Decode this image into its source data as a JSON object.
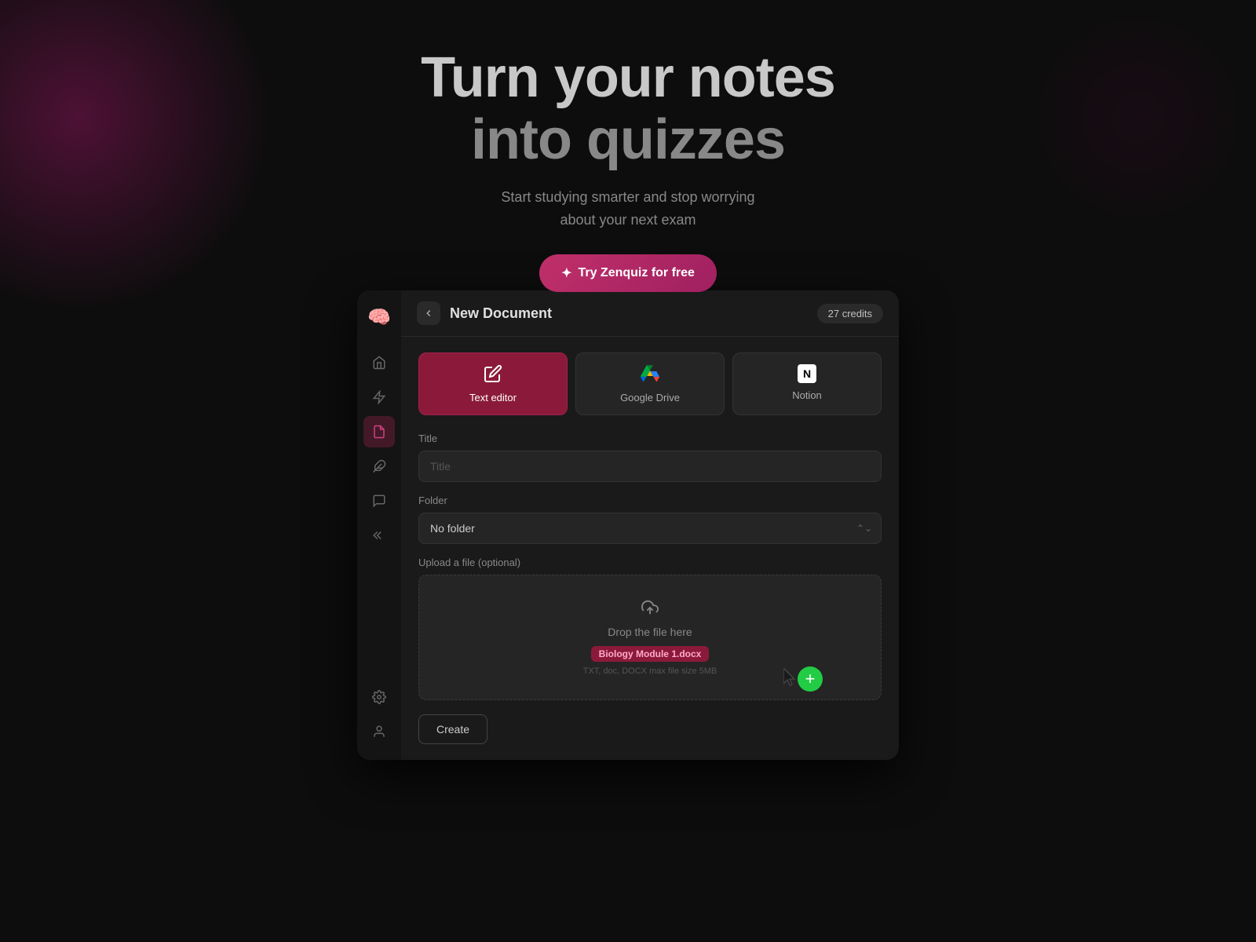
{
  "hero": {
    "title_line1": "Turn your notes",
    "title_line2": "into quizzes",
    "subtitle_line1": "Start studying smarter and stop worrying",
    "subtitle_line2": "about your next exam",
    "cta_icon": "✦",
    "cta_label": "Try Zenquiz for free"
  },
  "sidebar": {
    "logo_emoji": "🧠",
    "items": [
      {
        "id": "home",
        "icon": "⌂",
        "active": false
      },
      {
        "id": "lightning",
        "icon": "⚡",
        "active": false
      },
      {
        "id": "document",
        "icon": "📄",
        "active": true
      },
      {
        "id": "puzzle",
        "icon": "🧩",
        "active": false
      },
      {
        "id": "chat",
        "icon": "💬",
        "active": false
      },
      {
        "id": "collapse",
        "icon": "«",
        "active": false
      }
    ],
    "bottom_items": [
      {
        "id": "settings",
        "icon": "✺",
        "active": false
      },
      {
        "id": "profile",
        "icon": "👤",
        "active": false
      }
    ]
  },
  "header": {
    "back_label": "‹",
    "title": "New Document",
    "credits": "27 credits"
  },
  "source_tabs": [
    {
      "id": "text-editor",
      "label": "Text editor",
      "icon_type": "edit",
      "active": true
    },
    {
      "id": "google-drive",
      "label": "Google Drive",
      "icon_type": "gdrive",
      "active": false
    },
    {
      "id": "notion",
      "label": "Notion",
      "icon_type": "notion",
      "active": false
    }
  ],
  "form": {
    "title_label": "Title",
    "title_placeholder": "Title",
    "folder_label": "Folder",
    "folder_options": [
      "No folder"
    ],
    "folder_selected": "No folder",
    "upload_label": "Upload a file (optional)",
    "upload_drop_text": "Drop the file here",
    "upload_file_tag": "Biology Module 1.docx",
    "upload_sub_text": "TXT, doc, DOCX max file size 5MB",
    "create_button": "Create"
  }
}
